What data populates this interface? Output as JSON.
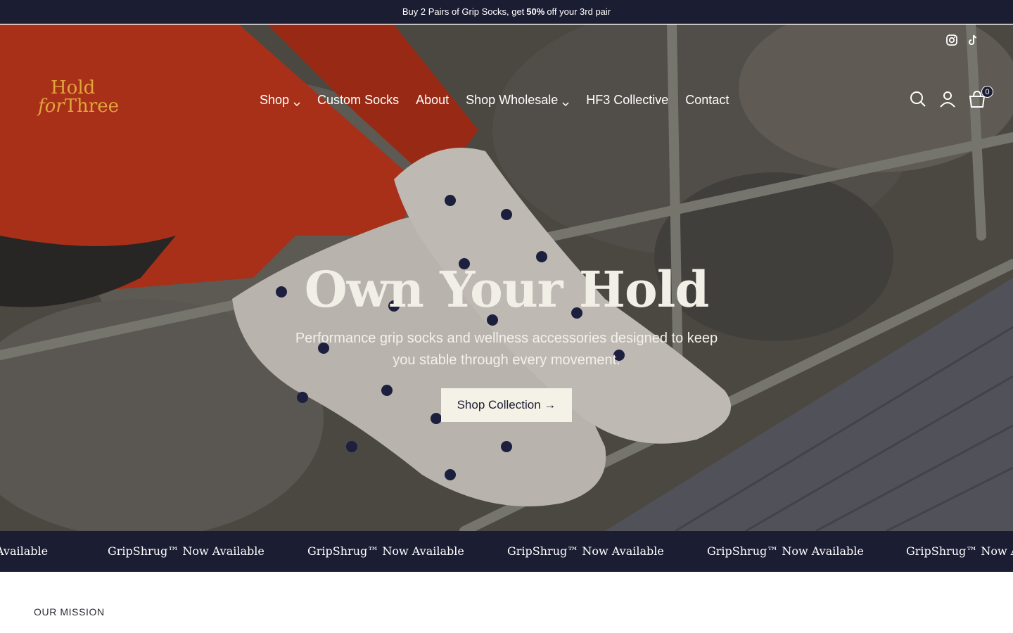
{
  "announcement": {
    "before": "Buy 2 Pairs of Grip Socks, get",
    "bold": "50%",
    "after": "off your 3rd pair"
  },
  "header": {
    "logo_line1": "Hold",
    "logo_line2_italic": "for",
    "logo_line2_rest": "Three",
    "nav": {
      "shop": "Shop",
      "custom_socks": "Custom Socks",
      "about": "About",
      "shop_wholesale": "Shop Wholesale",
      "hf3_collective": "HF3 Collective",
      "contact": "Contact"
    },
    "cart_count": "0",
    "social_icons": [
      "instagram-icon",
      "tiktok-icon"
    ],
    "action_icons": [
      "search-icon",
      "account-icon",
      "cart-icon"
    ]
  },
  "hero": {
    "title": "Own Your Hold",
    "subtitle": "Performance grip socks and wellness accessories designed to keep you stable through every movement.",
    "cta": "Shop Collection →"
  },
  "marquee": {
    "text": "GripShrug™ Now Available",
    "first_partial": "Available",
    "last_partial": "GripShrug™ Now Avai"
  },
  "mission_label": "OUR MISSION",
  "colors": {
    "navy": "#1b1d33",
    "logo_gold": "#e0a53c",
    "cream": "#f4f1e6",
    "legging_red": "#c9361a"
  }
}
